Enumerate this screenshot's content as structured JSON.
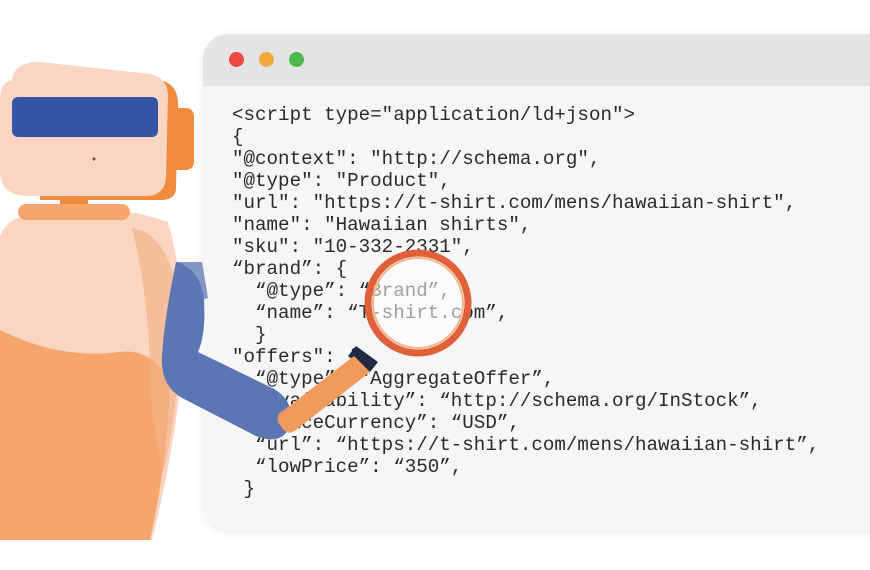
{
  "window": {
    "traffic_lights": [
      {
        "name": "close",
        "color": "#ec4a3f"
      },
      {
        "name": "minimize",
        "color": "#f1a93a"
      },
      {
        "name": "maximize",
        "color": "#4eb84e"
      }
    ]
  },
  "code": {
    "lines": [
      "<script type=\"application/ld+json\">",
      "{",
      "\"@context\": \"http://schema.org\",",
      "\"@type\": \"Product\",",
      "\"url\": \"https://t-shirt.com/mens/hawaiian-shirt\",",
      "\"name\": \"Hawaiian shirts\",",
      "\"sku\": \"10-332-2331\",",
      "“brand”: {",
      "  “@type”: “Brand”,",
      "  “name”: “T-shirt.com”,",
      "  }",
      "\"offers\": {",
      "  “@type”: “AggregateOffer”,",
      "  “availability”: “http://schema.org/InStock”,",
      "  “priceCurrency”: “USD”,",
      "  “url”: “https://t-shirt.com/mens/hawaiian-shirt”,",
      "  “lowPrice”: “350”,",
      " }"
    ]
  },
  "colors": {
    "robot_orange": "#f08a3c",
    "robot_light": "#f9d5c2",
    "robot_visor": "#3455a4",
    "robot_arm": "#5b76b3",
    "magnifier_ring": "#e0603a",
    "magnifier_handle": "#f09a5c"
  },
  "icons": {
    "robot": "robot-illustration",
    "magnifier": "magnifying-glass-icon"
  }
}
